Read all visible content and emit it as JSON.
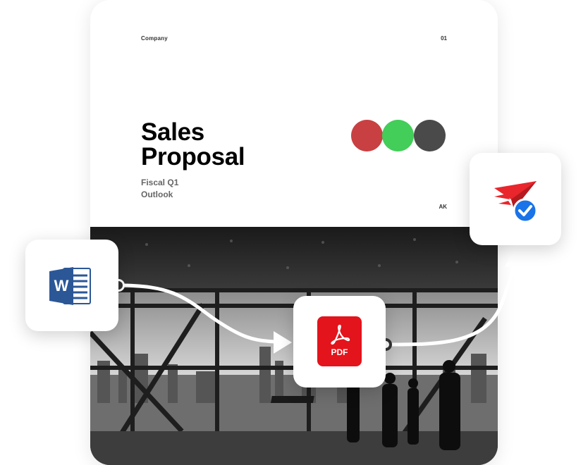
{
  "document": {
    "company_label": "Company",
    "page_number": "01",
    "title_line1": "Sales",
    "title_line2": "Proposal",
    "subtitle_line1": "Fiscal Q1",
    "subtitle_line2": "Outlook",
    "initials": "AK",
    "swatch_colors": [
      "#c94042",
      "#43cd59",
      "#4a4a4a"
    ],
    "photo": "Black and white office interior with large windows, city skyline and silhouetted people"
  },
  "workflow": {
    "source_app_icon": "word-icon",
    "source_letter": "W",
    "converter_label": "PDF",
    "converter_icon": "pdf-icon",
    "destination_icon": "send-verified-icon",
    "colors": {
      "word_blue": "#2b5797",
      "pdf_red": "#e3141b",
      "send_red": "#e8262c",
      "check_blue": "#1a73e8"
    }
  }
}
